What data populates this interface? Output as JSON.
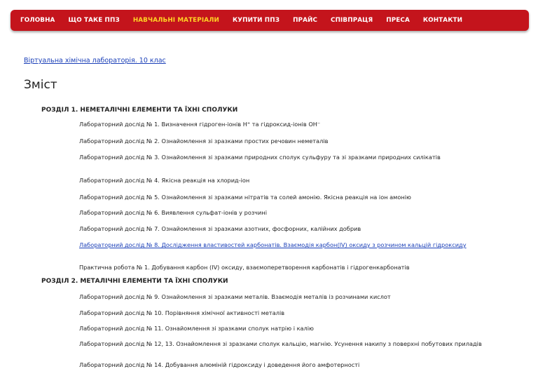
{
  "nav": {
    "items": [
      {
        "label": "ГОЛОВНА",
        "active": false
      },
      {
        "label": "ЩО ТАКЕ ППЗ",
        "active": false
      },
      {
        "label": "НАВЧАЛЬНІ МАТЕРІАЛИ",
        "active": true
      },
      {
        "label": "КУПИТИ ППЗ",
        "active": false
      },
      {
        "label": "ПРАЙС",
        "active": false
      },
      {
        "label": "СПІВПРАЦЯ",
        "active": false
      },
      {
        "label": "ПРЕСА",
        "active": false
      },
      {
        "label": "КОНТАКТИ",
        "active": false
      }
    ],
    "bar_color": "#c4141c",
    "active_color": "#ffd324"
  },
  "breadcrumb": "Віртуальна хімічна лабораторія. 10 клас",
  "page_title": "Зміст",
  "sections": [
    {
      "title": "РОЗДІЛ 1. НЕМЕТАЛІЧНІ ЕЛЕМЕНТИ ТА ЇХНІ СПОЛУКИ",
      "items": [
        {
          "text": "Лабораторний дослід № 1. Визначення гідроген-іонів H⁺ та гідроксид-іонів OH⁻",
          "link": false
        },
        {
          "text": "Лабораторний дослід № 2. Ознайомлення зі зразками простих речовин неметалів",
          "link": false
        },
        {
          "text": "Лабораторний дослід № 3. Ознайомлення зі зразками природних сполук сульфуру та зі зразками природних силікатів",
          "link": false
        },
        {
          "text": "Лабораторний дослід № 4. Якісна реакція на хлорид-іон",
          "link": false
        },
        {
          "text": "Лабораторний дослід № 5. Ознайомлення зі зразками нітратів та солей амонію. Якісна реакція на іон амонію",
          "link": false
        },
        {
          "text": "Лабораторний дослід № 6. Виявлення сульфат-іонів у розчині",
          "link": false
        },
        {
          "text": "Лабораторний дослід № 7. Ознайомлення зі зразками азотних, фосфорних, калійних добрив",
          "link": false
        },
        {
          "text": "Лабораторний дослід № 8. Дослідження властивостей карбонатів. Взаємодія карбон(IV) оксиду з розчином кальцій гідроксиду",
          "link": true
        },
        {
          "text": "Практична робота № 1. Добування карбон (IV) оксиду, взаємоперетворення карбонатів і гідрогенкарбонатів",
          "link": false
        }
      ]
    },
    {
      "title": "РОЗДІЛ 2. МЕТАЛІЧНІ ЕЛЕМЕНТИ ТА ЇХНІ СПОЛУКИ",
      "items": [
        {
          "text": "Лабораторний дослід № 9. Ознайомлення зі зразками металів. Взаємодія металів із розчинами кислот",
          "link": false
        },
        {
          "text": "Лабораторний дослід № 10. Порівняння хімічної активності металів",
          "link": false
        },
        {
          "text": "Лабораторний дослід № 11. Ознайомлення зі зразками сполук натрію і калію",
          "link": false
        },
        {
          "text": "Лабораторний дослід № 12, 13. Ознайомлення зі зразками сполук кальцію, магнію. Усунення накипу з поверхні побутових приладів",
          "link": false
        },
        {
          "text": "Лабораторний дослід № 14. Добування алюміній гідроксиду і доведення його амфотерності",
          "link": false
        }
      ]
    }
  ]
}
